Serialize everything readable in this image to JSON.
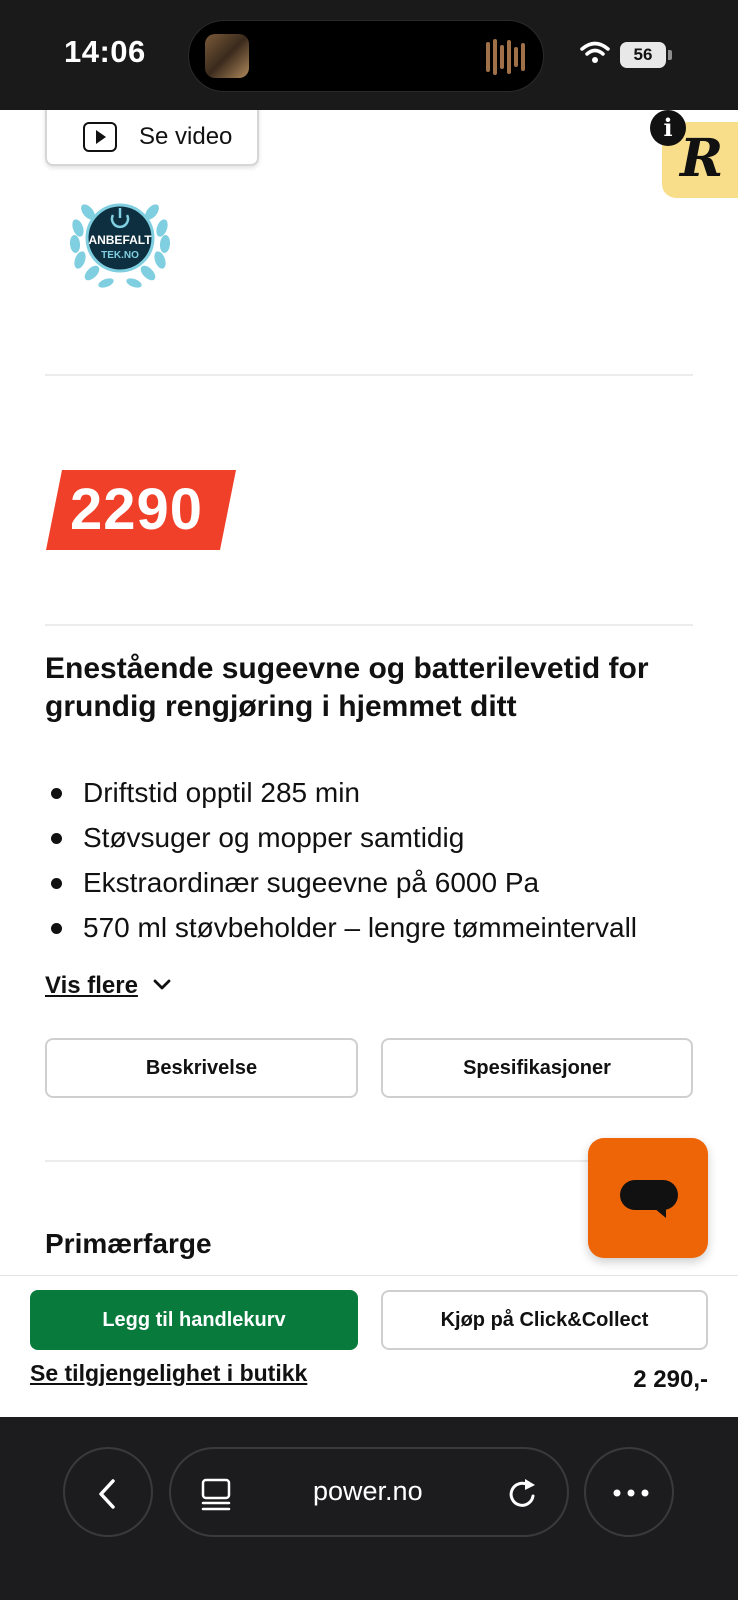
{
  "status_bar": {
    "time": "14:06",
    "battery": "56"
  },
  "product": {
    "video_button_label": "Se video",
    "award_badge": "ANBEFALT TEK.NO",
    "price": "2290",
    "headline": "Enestående sugeevne og batterilevetid for grundig rengjøring i hjemmet ditt",
    "features": [
      "Driftstid opptil 285 min",
      "Støvsuger og mopper samtidig",
      "Ekstraordinær sugeevne på 6000 Pa",
      "570 ml støvbeholder – lengre tømmeintervall"
    ],
    "show_more_label": "Vis flere",
    "tabs": [
      {
        "label": "Beskrivelse"
      },
      {
        "label": "Spesifikasjoner"
      }
    ],
    "section_title": "Primærfarge"
  },
  "action_bar": {
    "add_to_cart_label": "Legg til handlekurv",
    "click_collect_label": "Kjøp på Click&Collect",
    "availability_link": "Se tilgjengelighet i butikk",
    "price_display": "2 290,-"
  },
  "browser": {
    "url": "power.no"
  },
  "colors": {
    "price_tag": "#f0402a",
    "cart_button": "#077a3c",
    "chat_button": "#ee6508",
    "r_badge": "#f8dd8a"
  },
  "icons": {
    "video": "play-icon",
    "chevron": "chevron-down-icon",
    "chat": "chat-icon",
    "back": "back-chevron-icon",
    "tabs": "tabs-icon",
    "reload": "reload-icon",
    "more": "more-dots-icon",
    "info": "info-icon"
  }
}
